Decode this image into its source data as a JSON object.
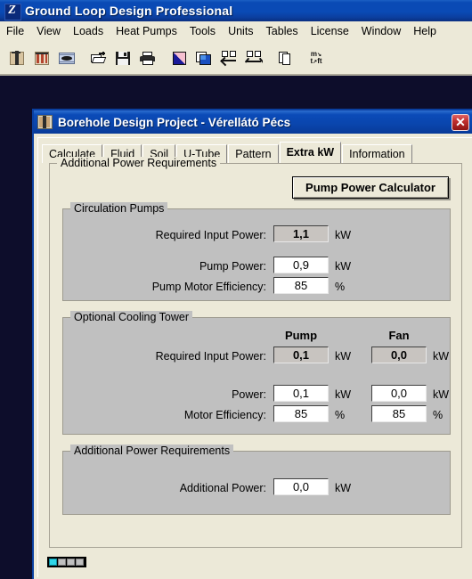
{
  "app": {
    "title": "Ground Loop Design Professional",
    "icon": "app-logo-icon",
    "menu": [
      "File",
      "View",
      "Loads",
      "Heat Pumps",
      "Tools",
      "Units",
      "Tables",
      "License",
      "Window",
      "Help"
    ],
    "toolbar": [
      {
        "name": "borehole-single-icon",
        "group": 1
      },
      {
        "name": "borehole-field-icon",
        "group": 1
      },
      {
        "name": "horizontal-loop-icon",
        "group": 1
      },
      {
        "name": "open-folder-icon",
        "group": 2
      },
      {
        "name": "save-icon",
        "group": 2
      },
      {
        "name": "print-icon",
        "group": 2
      },
      {
        "name": "new-project-icon",
        "group": 3
      },
      {
        "name": "copy-project-icon",
        "group": 3
      },
      {
        "name": "tile-vertical-icon",
        "group": 3
      },
      {
        "name": "tile-horizontal-icon",
        "group": 3
      },
      {
        "name": "duplicate-icon",
        "group": 4
      },
      {
        "name": "unit-convert-icon",
        "group": 5
      }
    ]
  },
  "dialog": {
    "icon": "borehole-project-icon",
    "title": "Borehole Design Project - Vérellátó Pécs",
    "close_label": "✕",
    "tabs": [
      {
        "label": "Calculate",
        "active": false
      },
      {
        "label": "Fluid",
        "active": false
      },
      {
        "label": "Soil",
        "active": false
      },
      {
        "label": "U-Tube",
        "active": false
      },
      {
        "label": "Pattern",
        "active": false
      },
      {
        "label": "Extra kW",
        "active": true
      },
      {
        "label": "Information",
        "active": false
      }
    ],
    "outer_group_label": "Additional Power Requirements",
    "pump_power_calculator_button": "Pump Power Calculator",
    "circulation_pumps": {
      "group_label": "Circulation Pumps",
      "rows": [
        {
          "label": "Required Input Power:",
          "value": "1,1",
          "unit": "kW",
          "readonly": true
        },
        {
          "label": "Pump Power:",
          "value": "0,9",
          "unit": "kW",
          "readonly": false
        },
        {
          "label": "Pump Motor Efficiency:",
          "value": "85",
          "unit": "%",
          "readonly": false
        }
      ]
    },
    "cooling_tower": {
      "group_label": "Optional Cooling Tower",
      "col_headers": [
        "Pump",
        "Fan"
      ],
      "rows": [
        {
          "label": "Required Input Power:",
          "pump_value": "0,1",
          "fan_value": "0,0",
          "unit": "kW",
          "readonly": true
        },
        {
          "label": "Power:",
          "pump_value": "0,1",
          "fan_value": "0,0",
          "unit": "kW",
          "readonly": false
        },
        {
          "label": "Motor Efficiency:",
          "pump_value": "85",
          "fan_value": "85",
          "unit": "%",
          "readonly": false
        }
      ]
    },
    "additional_power": {
      "group_label": "Additional Power Requirements",
      "rows": [
        {
          "label": "Additional Power:",
          "value": "0,0",
          "unit": "kW",
          "readonly": false
        }
      ]
    },
    "steps": [
      true,
      false,
      false,
      false
    ]
  },
  "colors": {
    "titlebar_blue": "#0a4ab5",
    "dialog_face": "#ece9d8",
    "group_face": "#c0c0c0",
    "mdi_background": "#0d0d2b",
    "step_active": "#2fd6e8",
    "close_red": "#c23030"
  }
}
